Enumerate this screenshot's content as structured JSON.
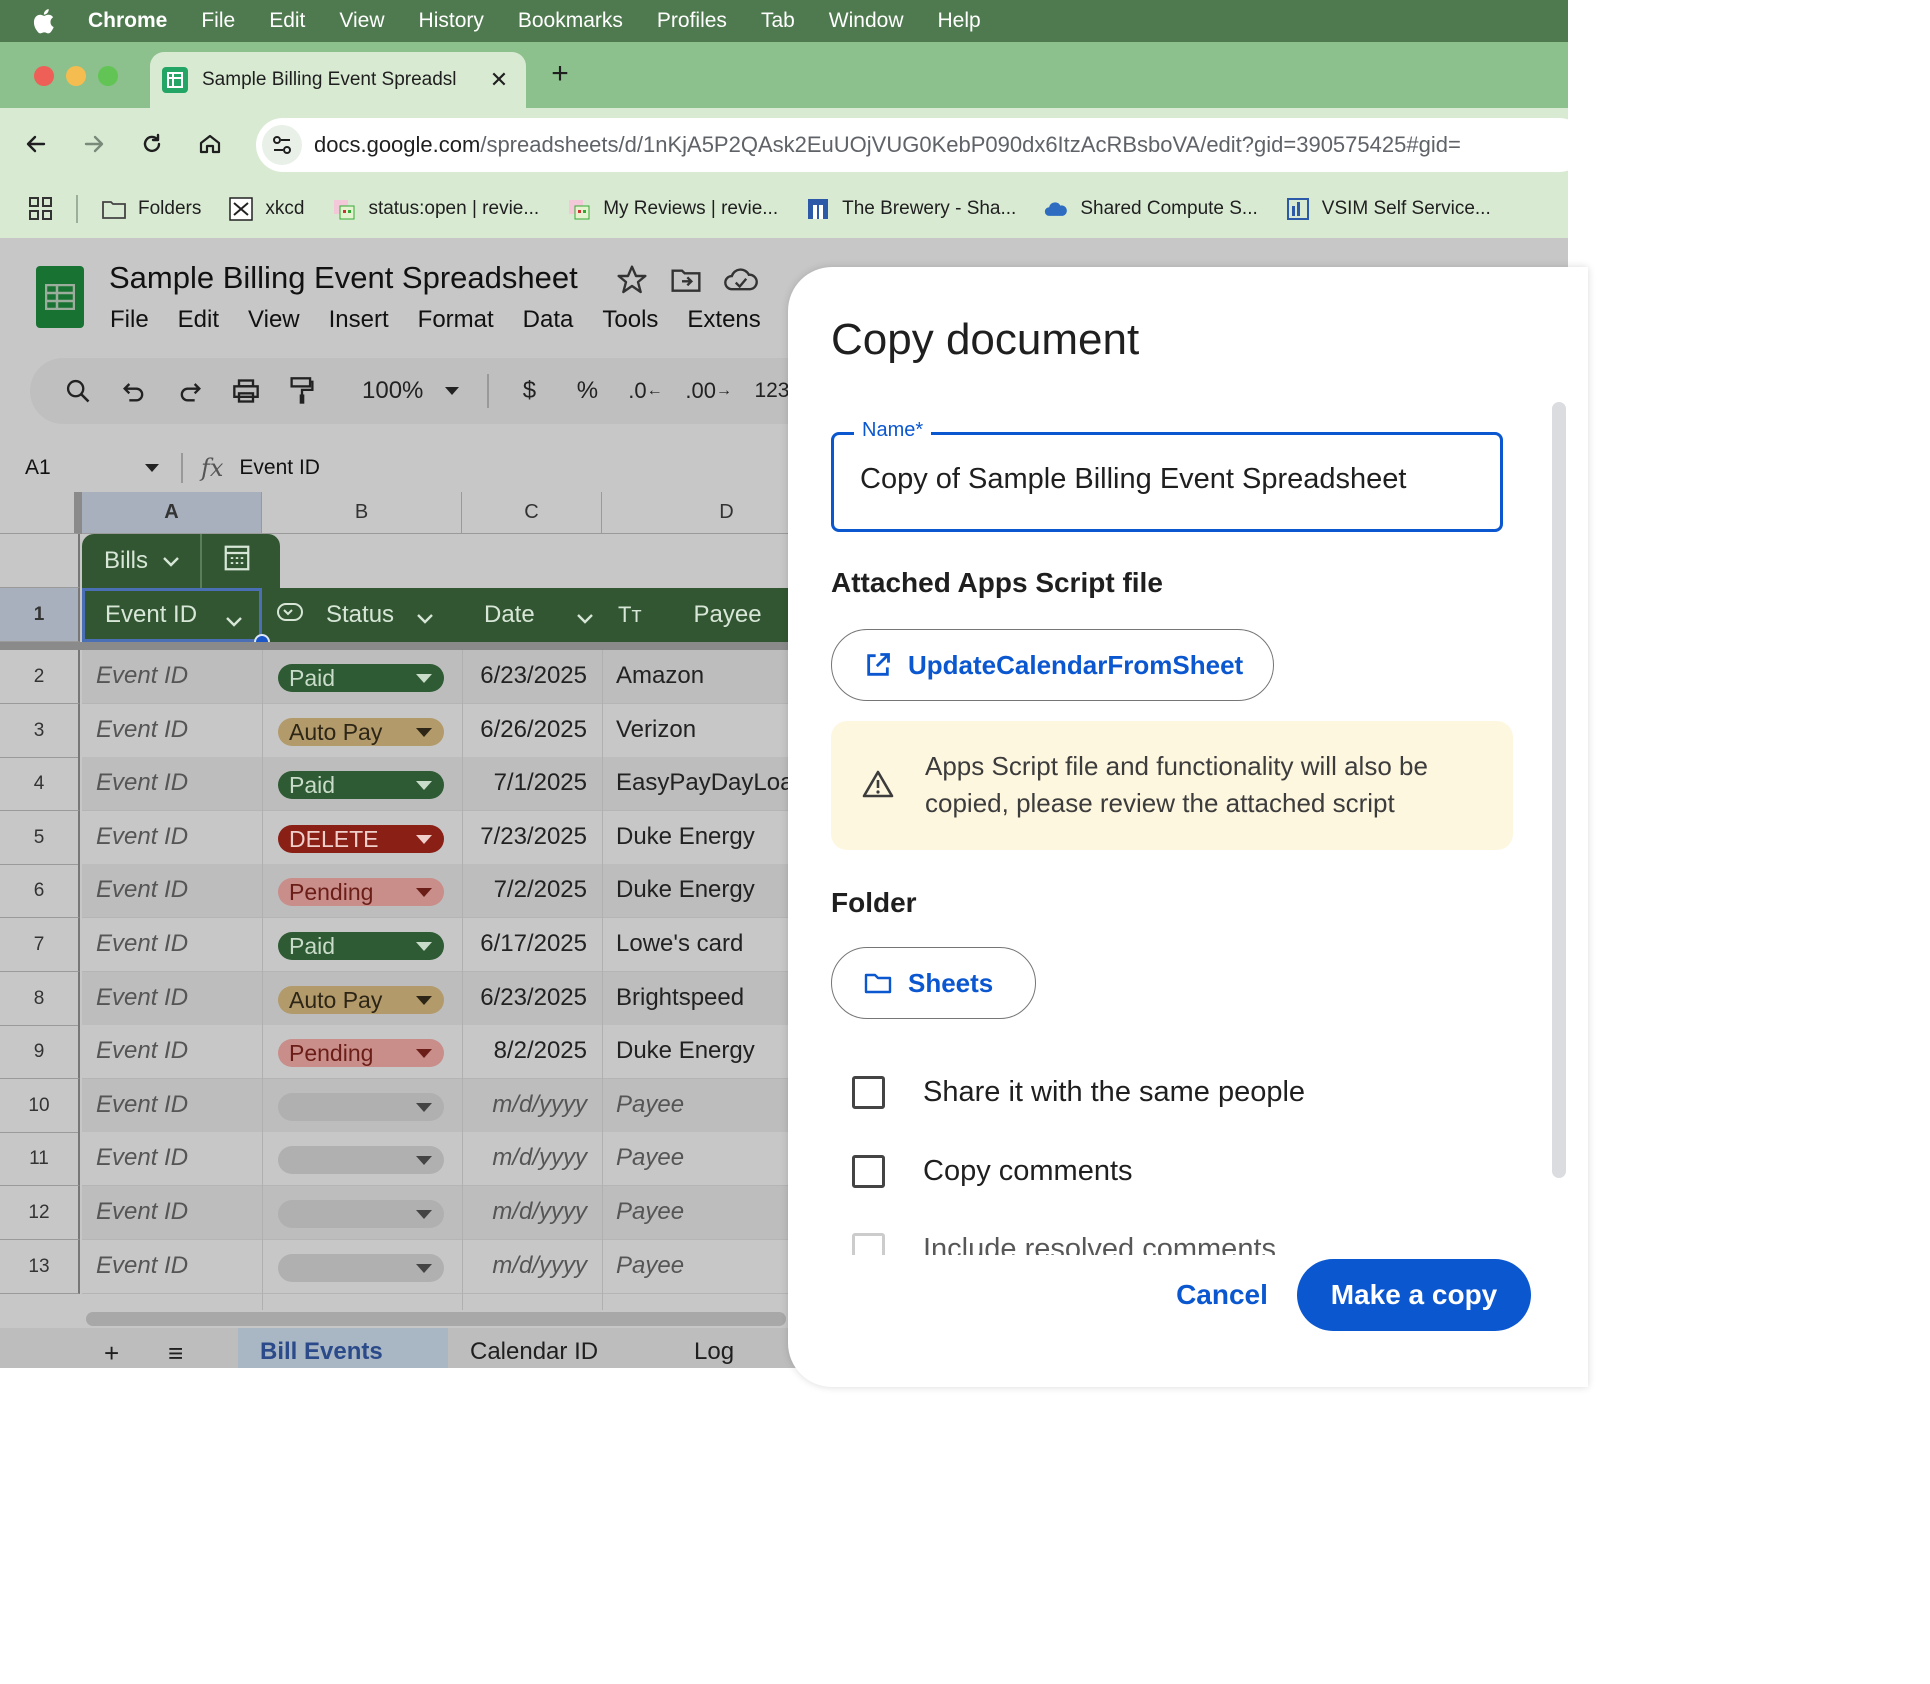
{
  "menubar": {
    "app": "Chrome",
    "items": [
      "File",
      "Edit",
      "View",
      "History",
      "Bookmarks",
      "Profiles",
      "Tab",
      "Window",
      "Help"
    ]
  },
  "browser": {
    "tab_title": "Sample Billing Event Spreadsl",
    "url_host": "docs.google.com",
    "url_path": "/spreadsheets/d/1nKjA5P2QAsk2EuUOjVUG0KebP090dx6ItzAcRBsboVA/edit?gid=390575425#gid=",
    "bookmarks": [
      {
        "label": "Folders",
        "icon": "folder-icon"
      },
      {
        "label": "xkcd",
        "icon": "xkcd-icon"
      },
      {
        "label": "status:open | revie...",
        "icon": "gerrit-icon"
      },
      {
        "label": "My Reviews | revie...",
        "icon": "gerrit-icon"
      },
      {
        "label": "The Brewery - Sha...",
        "icon": "sharepoint-icon"
      },
      {
        "label": "Shared Compute S...",
        "icon": "cloud-icon"
      },
      {
        "label": "VSIM Self Service...",
        "icon": "vsim-icon"
      }
    ]
  },
  "sheet": {
    "title": "Sample Billing Event Spreadsheet",
    "menu": [
      "File",
      "Edit",
      "View",
      "Insert",
      "Format",
      "Data",
      "Tools",
      "Extens"
    ],
    "zoom": "100%",
    "fmt": {
      "currency": "$",
      "percent": "%",
      "dec_less": ".0",
      "dec_more": ".00",
      "number": "123"
    },
    "cell_ref": "A1",
    "fx": "fx",
    "formula_value": "Event ID",
    "columns": [
      "A",
      "B",
      "C",
      "D"
    ],
    "table_name": "Bills",
    "headers": {
      "event_id": "Event ID",
      "status": "Status",
      "date": "Date",
      "payee": "Payee",
      "text_type": "Tт"
    },
    "row_numbers": [
      "1",
      "2",
      "3",
      "4",
      "5",
      "6",
      "7",
      "8",
      "9",
      "10",
      "11",
      "12",
      "13"
    ],
    "rows": [
      {
        "event_id": "Event ID",
        "status": "Paid",
        "date": "6/23/2025",
        "payee": "Amazon"
      },
      {
        "event_id": "Event ID",
        "status": "Auto Pay",
        "date": "6/26/2025",
        "payee": "Verizon"
      },
      {
        "event_id": "Event ID",
        "status": "Paid",
        "date": "7/1/2025",
        "payee": "EasyPayDayLoar"
      },
      {
        "event_id": "Event ID",
        "status": "DELETE",
        "date": "7/23/2025",
        "payee": "Duke Energy"
      },
      {
        "event_id": "Event ID",
        "status": "Pending",
        "date": "7/2/2025",
        "payee": "Duke Energy"
      },
      {
        "event_id": "Event ID",
        "status": "Paid",
        "date": "6/17/2025",
        "payee": "Lowe's card"
      },
      {
        "event_id": "Event ID",
        "status": "Auto Pay",
        "date": "6/23/2025",
        "payee": "Brightspeed"
      },
      {
        "event_id": "Event ID",
        "status": "Pending",
        "date": "8/2/2025",
        "payee": "Duke Energy"
      },
      {
        "event_id": "Event ID",
        "status": "",
        "date": "m/d/yyyy",
        "payee": "Payee"
      },
      {
        "event_id": "Event ID",
        "status": "",
        "date": "m/d/yyyy",
        "payee": "Payee"
      },
      {
        "event_id": "Event ID",
        "status": "",
        "date": "m/d/yyyy",
        "payee": "Payee"
      },
      {
        "event_id": "Event ID",
        "status": "",
        "date": "m/d/yyyy",
        "payee": "Payee"
      }
    ],
    "status_colors": {
      "Paid": {
        "bg": "#2e5a34",
        "fg": "#c9dcc9"
      },
      "Auto Pay": {
        "bg": "#b29a6a",
        "fg": "#2d2616"
      },
      "DELETE": {
        "bg": "#8a1f16",
        "fg": "#f0cfcb"
      },
      "Pending": {
        "bg": "#c98d8a",
        "fg": "#6b1e17"
      },
      "": {
        "bg": "#b0b0b0",
        "fg": "#333"
      }
    },
    "sheet_tabs": [
      "Bill Events",
      "Calendar ID",
      "Log"
    ]
  },
  "dialog": {
    "title": "Copy document",
    "name_label": "Name",
    "name_required": "*",
    "name_value": "Copy of Sample Billing Event Spreadsheet",
    "script_heading": "Attached Apps Script file",
    "script_button": "UpdateCalendarFromSheet",
    "warning": "Apps Script file and functionality will also be copied, please review the attached script",
    "folder_heading": "Folder",
    "folder_button": "Sheets",
    "options": [
      {
        "label": "Share it with the same people",
        "checked": false
      },
      {
        "label": "Copy comments",
        "checked": false
      },
      {
        "label": "Include resolved comments",
        "checked": false
      }
    ],
    "cancel": "Cancel",
    "confirm": "Make a copy"
  }
}
